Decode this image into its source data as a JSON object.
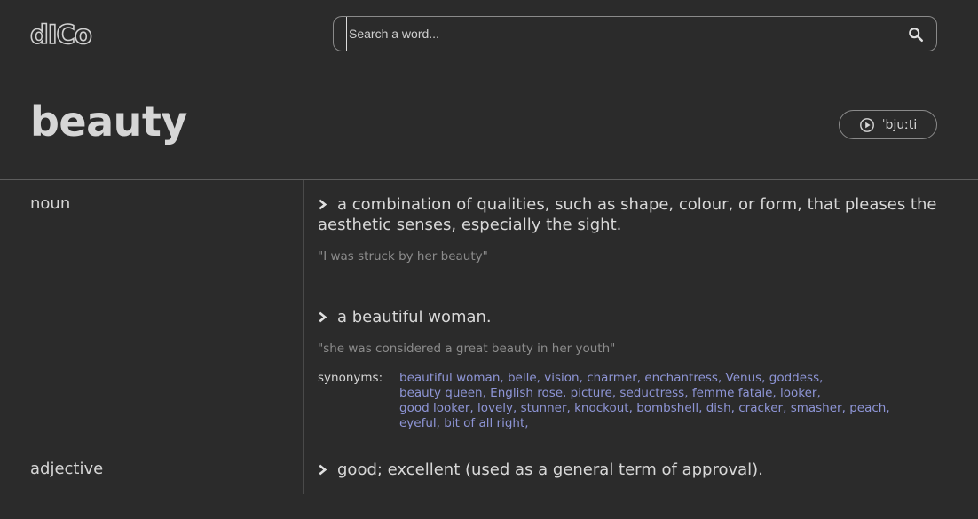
{
  "header": {
    "logo": "dICo",
    "search_placeholder": "Search a word...",
    "search_icon": "search-icon"
  },
  "entry": {
    "word": "beauty",
    "pronunciation": "ˈbjuːti",
    "play_icon": "play-circle-icon"
  },
  "senses": [
    {
      "pos": "noun",
      "definitions": [
        {
          "text": "a combination of qualities, such as shape, colour, or form, that pleases the aesthetic senses, especially the sight.",
          "example": "\"I was struck by her beauty\""
        },
        {
          "text": "a beautiful woman.",
          "example": "\"she was considered a great beauty in her youth\"",
          "synonyms_label": "synonyms:",
          "synonyms": [
            "beautiful woman,",
            "belle,",
            "vision,",
            "charmer,",
            "enchantress,",
            "Venus,",
            "goddess,",
            "beauty queen,",
            "English rose,",
            "picture,",
            "seductress,",
            "femme fatale,",
            "looker,",
            "good looker,",
            "lovely,",
            "stunner,",
            "knockout,",
            "bombshell,",
            "dish,",
            "cracker,",
            "smasher,",
            "peach,",
            "eyeful,",
            "bit of all right,"
          ]
        }
      ]
    },
    {
      "pos": "adjective",
      "definitions": [
        {
          "text": "good; excellent (used as a general term of approval)."
        }
      ]
    }
  ],
  "colors": {
    "background": "#2b2b2b",
    "text": "#d6d6d6",
    "example": "#8c8c8c",
    "synonym_link": "#8e95d6",
    "border": "#8a8a8a"
  }
}
